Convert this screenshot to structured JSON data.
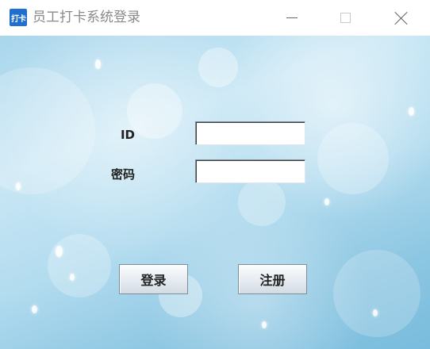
{
  "window": {
    "title": "员工打卡系统登录",
    "icon_text": "打卡",
    "accent_color": "#1e6fd0"
  },
  "form": {
    "id_label": "ID",
    "id_value": "",
    "password_label": "密码",
    "password_value": ""
  },
  "buttons": {
    "login_label": "登录",
    "register_label": "注册"
  }
}
